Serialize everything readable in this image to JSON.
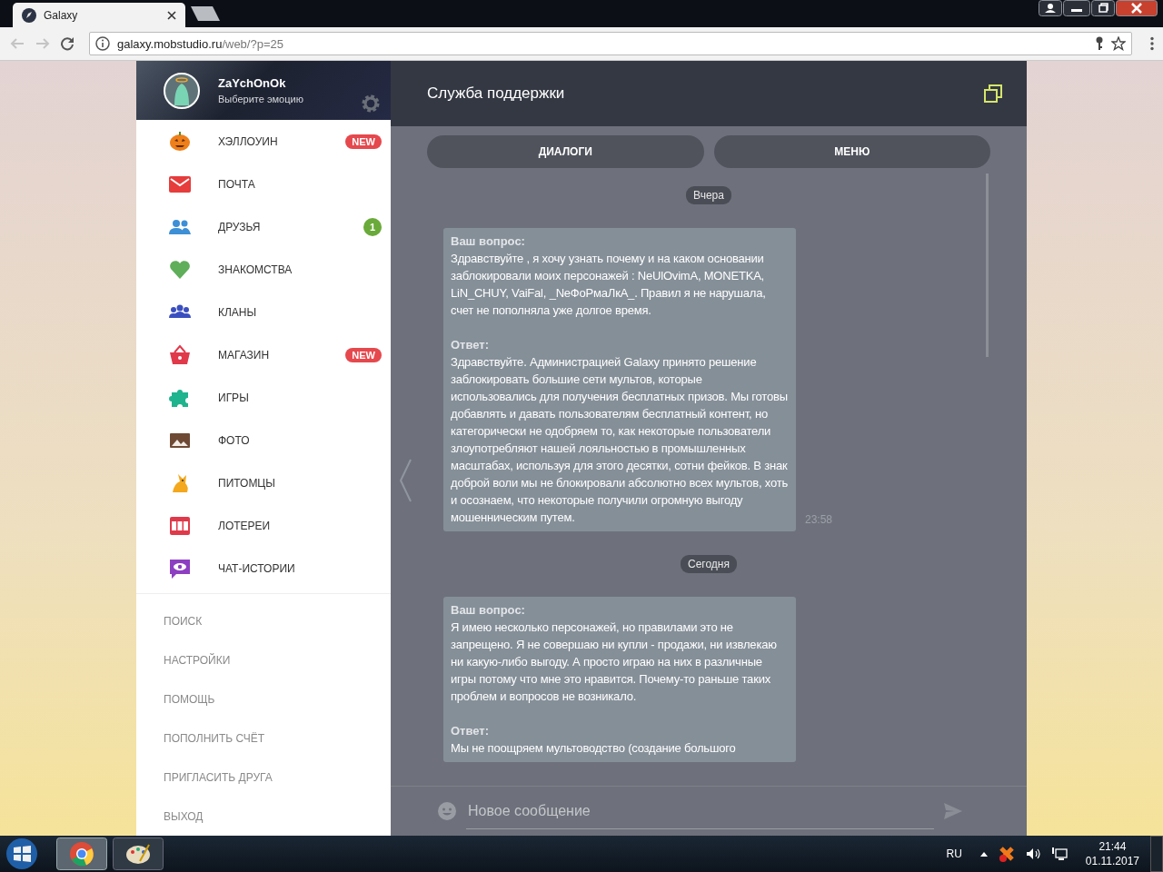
{
  "browser": {
    "tab_title": "Galaxy",
    "url_host": "galaxy.mobstudio.ru",
    "url_path": "/web/?p=25"
  },
  "profile": {
    "name": "ZaYchOnOk",
    "status": "Выберите эмоцию"
  },
  "menu": [
    {
      "label": "ХЭЛЛОУИН",
      "badge": {
        "text": "NEW",
        "kind": "new"
      }
    },
    {
      "label": "ПОЧТА"
    },
    {
      "label": "ДРУЗЬЯ",
      "badge": {
        "text": "1",
        "kind": "count"
      }
    },
    {
      "label": "ЗНАКОМСТВА"
    },
    {
      "label": "КЛАНЫ"
    },
    {
      "label": "МАГАЗИН",
      "badge": {
        "text": "NEW",
        "kind": "new"
      }
    },
    {
      "label": "ИГРЫ"
    },
    {
      "label": "ФОТО"
    },
    {
      "label": "ПИТОМЦЫ"
    },
    {
      "label": "ЛОТЕРЕИ"
    },
    {
      "label": "ЧАТ-ИСТОРИИ"
    }
  ],
  "secondary_menu": [
    "ПОИСК",
    "НАСТРОЙКИ",
    "ПОМОЩЬ",
    "ПОПОЛНИТЬ СЧЁТ",
    "ПРИГЛАСИТЬ ДРУГА",
    "ВЫХОД"
  ],
  "chat": {
    "title": "Служба поддержки",
    "buttons": [
      "ДИАЛОГИ",
      "МЕНЮ"
    ],
    "messages": [
      {
        "kind": "date",
        "text": "Вчера"
      },
      {
        "kind": "ticket",
        "question_label": "Ваш вопрос:",
        "question": "Здравствуйте , я хочу узнать почему и на каком основании заблокировали моих персонажей : NeUlOvimA, MONETKA, LiN_CHUY, VaiFal, _NeФоРмаЛкА_. Правил я не нарушала, счет не пополняла уже долгое время.",
        "answer_label": "Ответ:",
        "answer": "Здравствуйте. Администрацией Galaxy принято решение заблокировать большие сети мультов, которые использовались для получения бесплатных призов. Мы готовы добавлять и давать пользователям бесплатный контент, но категорически не одобряем то, как некоторые пользователи злоупотребляют нашей лояльностью в промышленных масштабах, используя для этого десятки, сотни фейков. В знак доброй воли мы не блокировали абсолютно всех мультов, хоть и осознаем, что некоторые получили огромную выгоду мошенническим путем.",
        "time": "23:58"
      },
      {
        "kind": "date",
        "text": "Сегодня"
      },
      {
        "kind": "ticket",
        "question_label": "Ваш вопрос:",
        "question": "Я имею несколько персонажей, но правилами это не запрещено. Я не совершаю ни купли - продажи, ни извлекаю ни какую-либо выгоду. А просто играю на них в различные игры потому что мне это нравится. Почему-то раньше таких проблем и вопросов не возникало.",
        "answer_label": "Ответ:",
        "answer": "Мы не поощряем мультоводство (создание большого"
      }
    ],
    "composer_placeholder": "Новое сообщение"
  },
  "taskbar": {
    "language": "RU",
    "time": "21:44",
    "date": "01.11.2017"
  }
}
